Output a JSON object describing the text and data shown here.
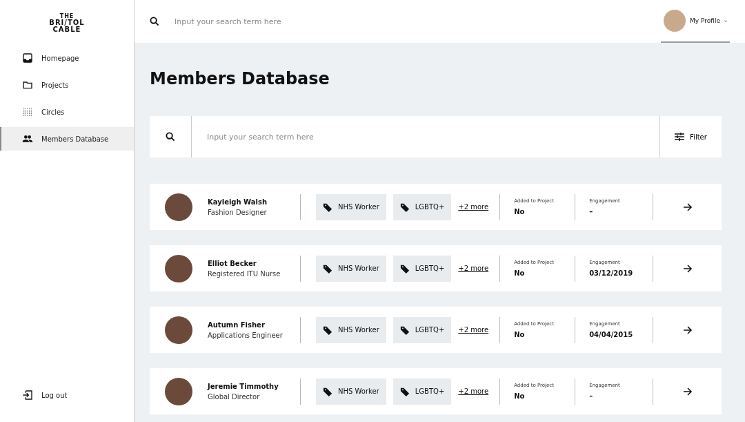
{
  "logo": {
    "lines": [
      "THE",
      "BRI/TOL",
      "CABLE"
    ]
  },
  "sidebar": {
    "items": [
      {
        "label": "Homepage",
        "selected": false
      },
      {
        "label": "Projects",
        "selected": false
      },
      {
        "label": "Circles",
        "selected": false
      },
      {
        "label": "Members Database",
        "selected": true
      }
    ],
    "logout": "Log out"
  },
  "topbar": {
    "search_placeholder": "Input your search term here",
    "profile": "My Profile"
  },
  "page_title": "Members Database",
  "search": {
    "placeholder": "Input your search term here",
    "filter": "Filter"
  },
  "members": [
    {
      "name": "Kayleigh Walsh",
      "role": "Fashion Designer",
      "tags": [
        "NHS Worker",
        "LGBTQ+"
      ],
      "more": "+2 more",
      "added_label": "Added to Project",
      "added": "No",
      "engagement_label": "Engagement",
      "engagement": "–"
    },
    {
      "name": "Elliot Becker",
      "role": "Registered ITU Nurse",
      "tags": [
        "NHS Worker",
        "LGBTQ+"
      ],
      "more": "+2 more",
      "added_label": "Added to Project",
      "added": "No",
      "engagement_label": "Engagement",
      "engagement": "03/12/2019"
    },
    {
      "name": "Autumn Fisher",
      "role": "Applications Engineer",
      "tags": [
        "NHS Worker",
        "LGBTQ+"
      ],
      "more": "+2 more",
      "added_label": "Added to Project",
      "added": "No",
      "engagement_label": "Engagement",
      "engagement": "04/04/2015"
    },
    {
      "name": "Jeremie Timmothy",
      "role": "Global Director",
      "tags": [
        "NHS Worker",
        "LGBTQ+"
      ],
      "more": "+2 more",
      "added_label": "Added to Project",
      "added": "No",
      "engagement_label": "Engagement",
      "engagement": "–"
    }
  ]
}
